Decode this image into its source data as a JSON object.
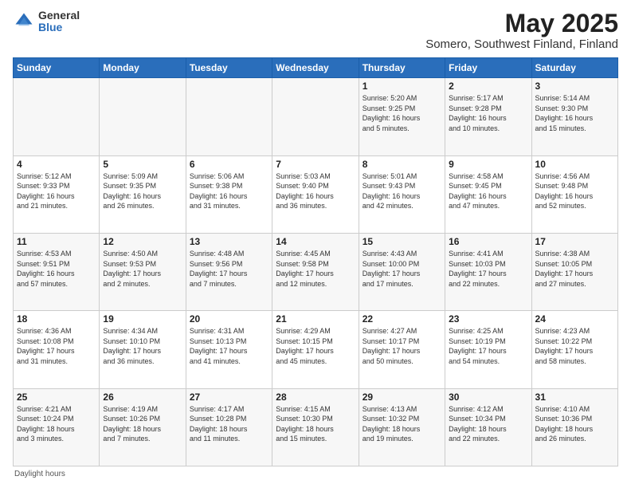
{
  "header": {
    "logo_general": "General",
    "logo_blue": "Blue",
    "title": "May 2025",
    "subtitle": "Somero, Southwest Finland, Finland"
  },
  "days_of_week": [
    "Sunday",
    "Monday",
    "Tuesday",
    "Wednesday",
    "Thursday",
    "Friday",
    "Saturday"
  ],
  "footer": {
    "daylight_hours": "Daylight hours"
  },
  "weeks": [
    [
      {
        "num": "",
        "info": ""
      },
      {
        "num": "",
        "info": ""
      },
      {
        "num": "",
        "info": ""
      },
      {
        "num": "",
        "info": ""
      },
      {
        "num": "1",
        "info": "Sunrise: 5:20 AM\nSunset: 9:25 PM\nDaylight: 16 hours\nand 5 minutes."
      },
      {
        "num": "2",
        "info": "Sunrise: 5:17 AM\nSunset: 9:28 PM\nDaylight: 16 hours\nand 10 minutes."
      },
      {
        "num": "3",
        "info": "Sunrise: 5:14 AM\nSunset: 9:30 PM\nDaylight: 16 hours\nand 15 minutes."
      }
    ],
    [
      {
        "num": "4",
        "info": "Sunrise: 5:12 AM\nSunset: 9:33 PM\nDaylight: 16 hours\nand 21 minutes."
      },
      {
        "num": "5",
        "info": "Sunrise: 5:09 AM\nSunset: 9:35 PM\nDaylight: 16 hours\nand 26 minutes."
      },
      {
        "num": "6",
        "info": "Sunrise: 5:06 AM\nSunset: 9:38 PM\nDaylight: 16 hours\nand 31 minutes."
      },
      {
        "num": "7",
        "info": "Sunrise: 5:03 AM\nSunset: 9:40 PM\nDaylight: 16 hours\nand 36 minutes."
      },
      {
        "num": "8",
        "info": "Sunrise: 5:01 AM\nSunset: 9:43 PM\nDaylight: 16 hours\nand 42 minutes."
      },
      {
        "num": "9",
        "info": "Sunrise: 4:58 AM\nSunset: 9:45 PM\nDaylight: 16 hours\nand 47 minutes."
      },
      {
        "num": "10",
        "info": "Sunrise: 4:56 AM\nSunset: 9:48 PM\nDaylight: 16 hours\nand 52 minutes."
      }
    ],
    [
      {
        "num": "11",
        "info": "Sunrise: 4:53 AM\nSunset: 9:51 PM\nDaylight: 16 hours\nand 57 minutes."
      },
      {
        "num": "12",
        "info": "Sunrise: 4:50 AM\nSunset: 9:53 PM\nDaylight: 17 hours\nand 2 minutes."
      },
      {
        "num": "13",
        "info": "Sunrise: 4:48 AM\nSunset: 9:56 PM\nDaylight: 17 hours\nand 7 minutes."
      },
      {
        "num": "14",
        "info": "Sunrise: 4:45 AM\nSunset: 9:58 PM\nDaylight: 17 hours\nand 12 minutes."
      },
      {
        "num": "15",
        "info": "Sunrise: 4:43 AM\nSunset: 10:00 PM\nDaylight: 17 hours\nand 17 minutes."
      },
      {
        "num": "16",
        "info": "Sunrise: 4:41 AM\nSunset: 10:03 PM\nDaylight: 17 hours\nand 22 minutes."
      },
      {
        "num": "17",
        "info": "Sunrise: 4:38 AM\nSunset: 10:05 PM\nDaylight: 17 hours\nand 27 minutes."
      }
    ],
    [
      {
        "num": "18",
        "info": "Sunrise: 4:36 AM\nSunset: 10:08 PM\nDaylight: 17 hours\nand 31 minutes."
      },
      {
        "num": "19",
        "info": "Sunrise: 4:34 AM\nSunset: 10:10 PM\nDaylight: 17 hours\nand 36 minutes."
      },
      {
        "num": "20",
        "info": "Sunrise: 4:31 AM\nSunset: 10:13 PM\nDaylight: 17 hours\nand 41 minutes."
      },
      {
        "num": "21",
        "info": "Sunrise: 4:29 AM\nSunset: 10:15 PM\nDaylight: 17 hours\nand 45 minutes."
      },
      {
        "num": "22",
        "info": "Sunrise: 4:27 AM\nSunset: 10:17 PM\nDaylight: 17 hours\nand 50 minutes."
      },
      {
        "num": "23",
        "info": "Sunrise: 4:25 AM\nSunset: 10:19 PM\nDaylight: 17 hours\nand 54 minutes."
      },
      {
        "num": "24",
        "info": "Sunrise: 4:23 AM\nSunset: 10:22 PM\nDaylight: 17 hours\nand 58 minutes."
      }
    ],
    [
      {
        "num": "25",
        "info": "Sunrise: 4:21 AM\nSunset: 10:24 PM\nDaylight: 18 hours\nand 3 minutes."
      },
      {
        "num": "26",
        "info": "Sunrise: 4:19 AM\nSunset: 10:26 PM\nDaylight: 18 hours\nand 7 minutes."
      },
      {
        "num": "27",
        "info": "Sunrise: 4:17 AM\nSunset: 10:28 PM\nDaylight: 18 hours\nand 11 minutes."
      },
      {
        "num": "28",
        "info": "Sunrise: 4:15 AM\nSunset: 10:30 PM\nDaylight: 18 hours\nand 15 minutes."
      },
      {
        "num": "29",
        "info": "Sunrise: 4:13 AM\nSunset: 10:32 PM\nDaylight: 18 hours\nand 19 minutes."
      },
      {
        "num": "30",
        "info": "Sunrise: 4:12 AM\nSunset: 10:34 PM\nDaylight: 18 hours\nand 22 minutes."
      },
      {
        "num": "31",
        "info": "Sunrise: 4:10 AM\nSunset: 10:36 PM\nDaylight: 18 hours\nand 26 minutes."
      }
    ]
  ]
}
